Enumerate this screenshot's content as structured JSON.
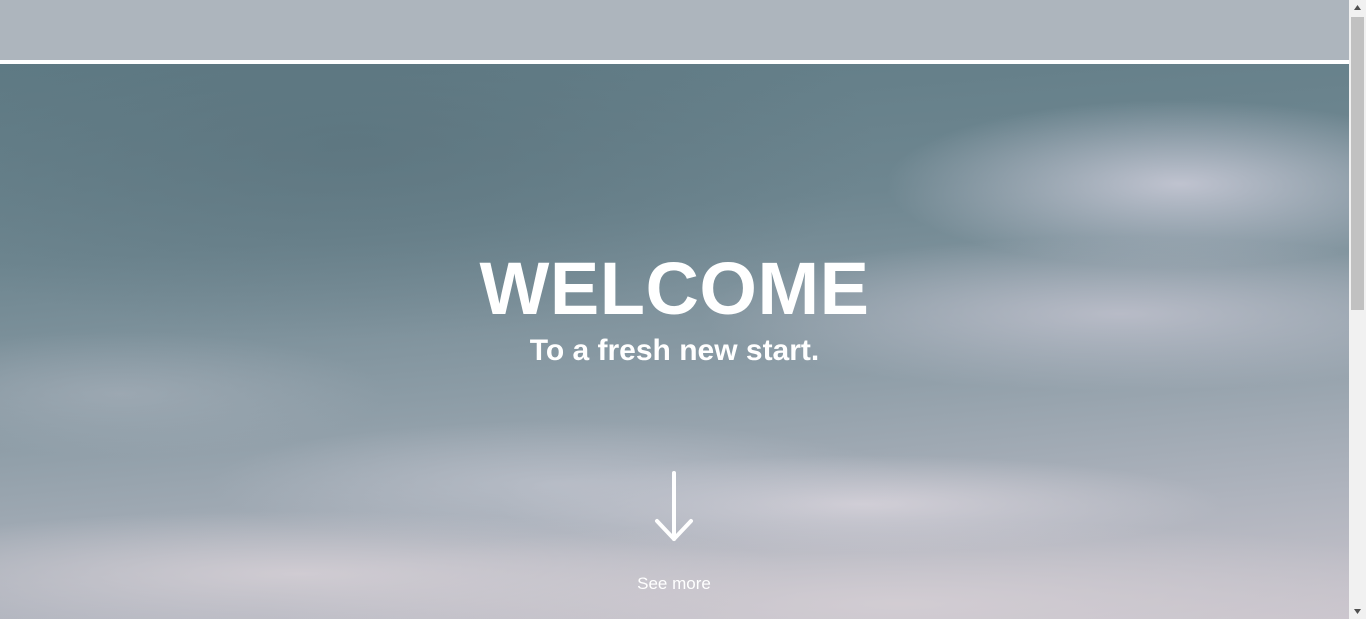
{
  "hero": {
    "title": "WELCOME",
    "subtitle": "To a fresh new start.",
    "see_more_label": "See more",
    "arrow_icon": "arrow-down-icon"
  },
  "colors": {
    "top_bar": "#adb5bd",
    "text": "#ffffff",
    "scrollbar_track": "#f1f1f1",
    "scrollbar_thumb": "#c1c1c1"
  }
}
